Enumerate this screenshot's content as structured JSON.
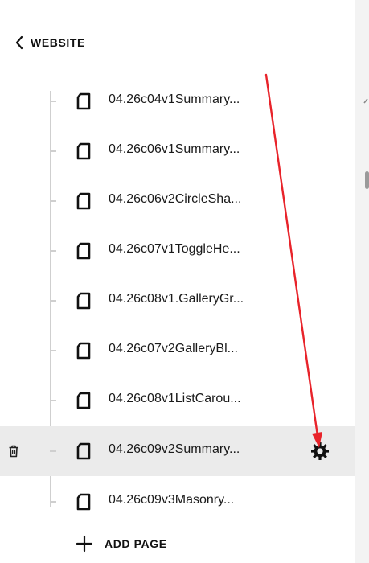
{
  "nav": {
    "back_label": "WEBSITE",
    "back_icon": "chevron-left-icon"
  },
  "pages": [
    {
      "label": "04.26c04v1Summary..."
    },
    {
      "label": "04.26c06v1Summary..."
    },
    {
      "label": "04.26c06v2CircleSha..."
    },
    {
      "label": "04.26c07v1ToggleHe..."
    },
    {
      "label": "04.26c08v1.GalleryGr..."
    },
    {
      "label": "04.26c07v2GalleryBl..."
    },
    {
      "label": "04.26c08v1ListCarou..."
    },
    {
      "label": "04.26c09v2Summary...",
      "selected": true
    },
    {
      "label": "04.26c09v3Masonry..."
    }
  ],
  "actions": {
    "add_page_label": "ADD PAGE"
  },
  "icons": {
    "page": "page-icon",
    "trash": "trash-icon",
    "gear": "gear-icon",
    "add": "plus-icon"
  },
  "colors": {
    "annotation_arrow": "#e8232a",
    "selected_row_bg": "#ebebeb",
    "tree_line": "#cfcfcf"
  }
}
